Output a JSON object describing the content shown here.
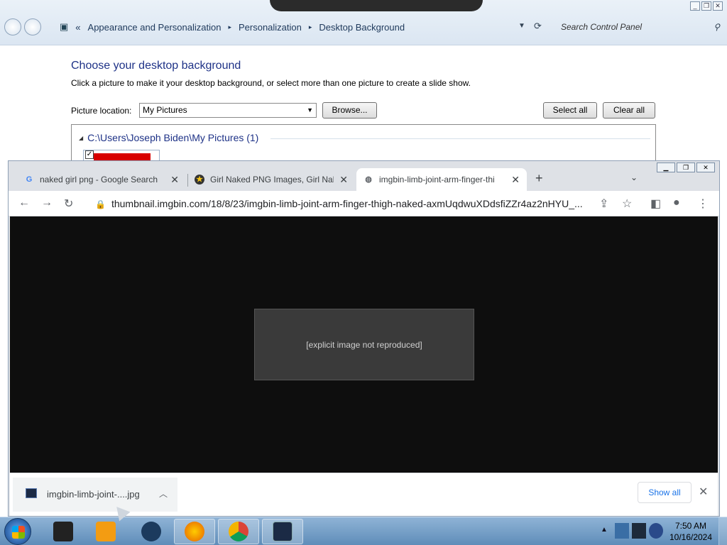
{
  "control_panel": {
    "breadcrumbs": [
      "Appearance and Personalization",
      "Personalization",
      "Desktop Background"
    ],
    "search_placeholder": "Search Control Panel",
    "heading": "Choose your desktop background",
    "subheading": "Click a picture to make it your desktop background, or select more than one picture to create a slide show.",
    "picture_location_label": "Picture location:",
    "picture_location_value": "My Pictures",
    "browse_label": "Browse...",
    "select_all_label": "Select all",
    "clear_all_label": "Clear all",
    "folder_path": "C:\\Users\\Joseph Biden\\My Pictures (1)"
  },
  "browser": {
    "tabs": [
      {
        "title": "naked girl png - Google Search",
        "icon": "google-icon"
      },
      {
        "title": "Girl Naked PNG Images, Girl Naki",
        "icon": "star-favicon"
      },
      {
        "title": "imgbin-limb-joint-arm-finger-thi",
        "icon": "globe-icon",
        "active": true
      }
    ],
    "url": "thumbnail.imgbin.com/18/8/23/imgbin-limb-joint-arm-finger-thigh-naked-axmUqdwuXDdsfiZZr4az2nHYU_...",
    "image_placeholder": "[explicit image not reproduced]",
    "download": {
      "filename": "imgbin-limb-joint-....jpg",
      "show_all_label": "Show all"
    }
  },
  "taskbar": {
    "time": "7:50 AM",
    "date": "10/16/2024"
  }
}
